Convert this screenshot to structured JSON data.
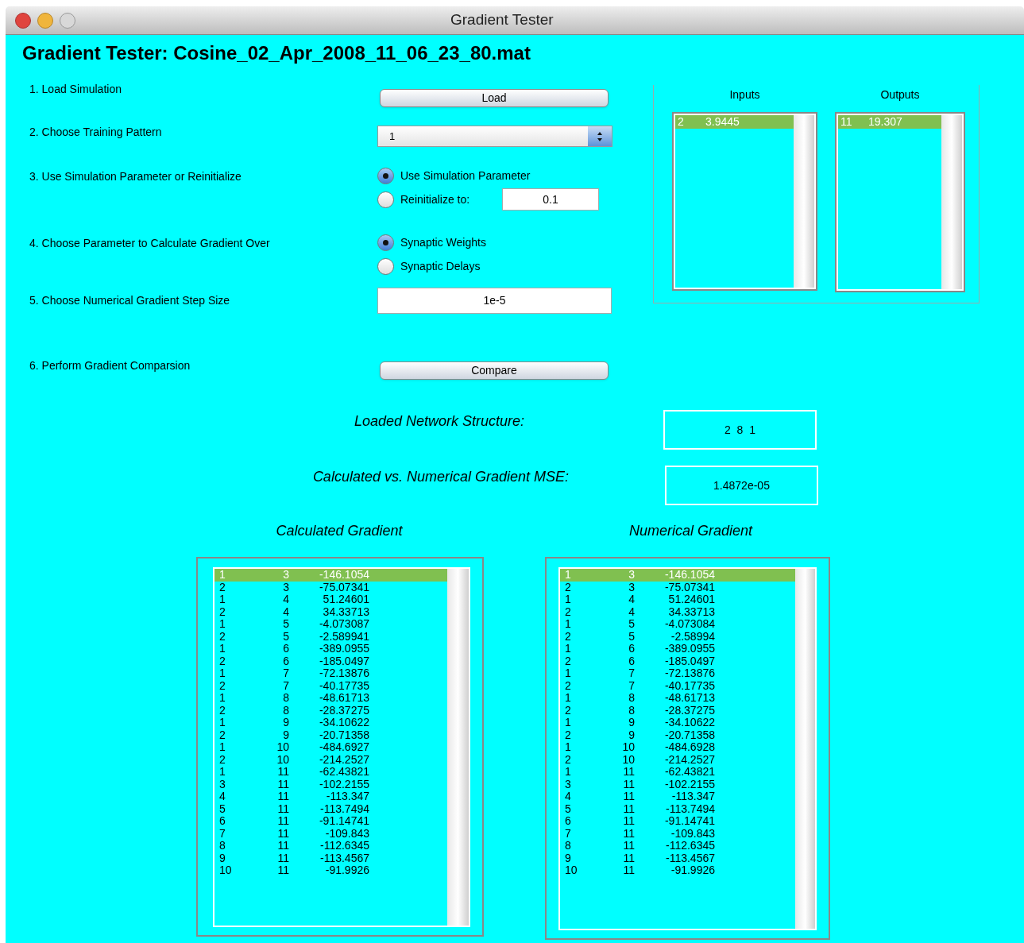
{
  "window": {
    "title": "Gradient Tester"
  },
  "heading": "Gradient Tester: Cosine_02_Apr_2008_11_06_23_80.mat",
  "steps": [
    {
      "kind": "button",
      "label": "1. Load Simulation",
      "button": "Load"
    },
    {
      "kind": "popup",
      "label": "2. Choose Training Pattern",
      "value": "1"
    },
    {
      "kind": "radios",
      "label": "3. Use Simulation Parameter or Reinitialize",
      "options": [
        {
          "label": "Use Simulation Parameter",
          "selected": true
        },
        {
          "label": "Reinitialize to:",
          "selected": false,
          "field": "0.1"
        }
      ]
    },
    {
      "kind": "radios",
      "label": "4. Choose Parameter to Calculate Gradient Over",
      "options": [
        {
          "label": "Synaptic Weights",
          "selected": true
        },
        {
          "label": "Synaptic Delays",
          "selected": false
        }
      ]
    },
    {
      "kind": "field",
      "label": "5. Choose Numerical Gradient Step Size",
      "value": "1e-5"
    },
    {
      "kind": "button",
      "label": "6. Perform Gradient Comparsion",
      "button": "Compare"
    }
  ],
  "io_panel": {
    "inputs": {
      "title": "Inputs",
      "rows": [
        {
          "cells": [
            "2",
            "3.9445"
          ],
          "selected": true
        }
      ]
    },
    "outputs": {
      "title": "Outputs",
      "rows": [
        {
          "cells": [
            "11",
            "19.307"
          ],
          "selected": true
        }
      ]
    }
  },
  "results": [
    {
      "label": "Loaded Network Structure:",
      "value": "2  8  1"
    },
    {
      "label": "Calculated vs. Numerical Gradient MSE:",
      "value": "1.4872e-05"
    }
  ],
  "gradients": [
    {
      "title": "Calculated Gradient",
      "rows": [
        {
          "cells": [
            "1",
            "3",
            "-146.1054"
          ],
          "selected": true
        },
        {
          "cells": [
            "2",
            "3",
            "-75.07341"
          ],
          "selected": false
        },
        {
          "cells": [
            "1",
            "4",
            "51.24601"
          ],
          "selected": false
        },
        {
          "cells": [
            "2",
            "4",
            "34.33713"
          ],
          "selected": false
        },
        {
          "cells": [
            "1",
            "5",
            "-4.073087"
          ],
          "selected": false
        },
        {
          "cells": [
            "2",
            "5",
            "-2.589941"
          ],
          "selected": false
        },
        {
          "cells": [
            "1",
            "6",
            "-389.0955"
          ],
          "selected": false
        },
        {
          "cells": [
            "2",
            "6",
            "-185.0497"
          ],
          "selected": false
        },
        {
          "cells": [
            "1",
            "7",
            "-72.13876"
          ],
          "selected": false
        },
        {
          "cells": [
            "2",
            "7",
            "-40.17735"
          ],
          "selected": false
        },
        {
          "cells": [
            "1",
            "8",
            "-48.61713"
          ],
          "selected": false
        },
        {
          "cells": [
            "2",
            "8",
            "-28.37275"
          ],
          "selected": false
        },
        {
          "cells": [
            "1",
            "9",
            "-34.10622"
          ],
          "selected": false
        },
        {
          "cells": [
            "2",
            "9",
            "-20.71358"
          ],
          "selected": false
        },
        {
          "cells": [
            "1",
            "10",
            "-484.6927"
          ],
          "selected": false
        },
        {
          "cells": [
            "2",
            "10",
            "-214.2527"
          ],
          "selected": false
        },
        {
          "cells": [
            "1",
            "11",
            "-62.43821"
          ],
          "selected": false
        },
        {
          "cells": [
            "3",
            "11",
            "-102.2155"
          ],
          "selected": false
        },
        {
          "cells": [
            "4",
            "11",
            "-113.347"
          ],
          "selected": false
        },
        {
          "cells": [
            "5",
            "11",
            "-113.7494"
          ],
          "selected": false
        },
        {
          "cells": [
            "6",
            "11",
            "-91.14741"
          ],
          "selected": false
        },
        {
          "cells": [
            "7",
            "11",
            "-109.843"
          ],
          "selected": false
        },
        {
          "cells": [
            "8",
            "11",
            "-112.6345"
          ],
          "selected": false
        },
        {
          "cells": [
            "9",
            "11",
            "-113.4567"
          ],
          "selected": false
        },
        {
          "cells": [
            "10",
            "11",
            "-91.9926"
          ],
          "selected": false
        }
      ]
    },
    {
      "title": "Numerical Gradient",
      "rows": [
        {
          "cells": [
            "1",
            "3",
            "-146.1054"
          ],
          "selected": true
        },
        {
          "cells": [
            "2",
            "3",
            "-75.07341"
          ],
          "selected": false
        },
        {
          "cells": [
            "1",
            "4",
            "51.24601"
          ],
          "selected": false
        },
        {
          "cells": [
            "2",
            "4",
            "34.33713"
          ],
          "selected": false
        },
        {
          "cells": [
            "1",
            "5",
            "-4.073084"
          ],
          "selected": false
        },
        {
          "cells": [
            "2",
            "5",
            "-2.58994"
          ],
          "selected": false
        },
        {
          "cells": [
            "1",
            "6",
            "-389.0955"
          ],
          "selected": false
        },
        {
          "cells": [
            "2",
            "6",
            "-185.0497"
          ],
          "selected": false
        },
        {
          "cells": [
            "1",
            "7",
            "-72.13876"
          ],
          "selected": false
        },
        {
          "cells": [
            "2",
            "7",
            "-40.17735"
          ],
          "selected": false
        },
        {
          "cells": [
            "1",
            "8",
            "-48.61713"
          ],
          "selected": false
        },
        {
          "cells": [
            "2",
            "8",
            "-28.37275"
          ],
          "selected": false
        },
        {
          "cells": [
            "1",
            "9",
            "-34.10622"
          ],
          "selected": false
        },
        {
          "cells": [
            "2",
            "9",
            "-20.71358"
          ],
          "selected": false
        },
        {
          "cells": [
            "1",
            "10",
            "-484.6928"
          ],
          "selected": false
        },
        {
          "cells": [
            "2",
            "10",
            "-214.2527"
          ],
          "selected": false
        },
        {
          "cells": [
            "1",
            "11",
            "-62.43821"
          ],
          "selected": false
        },
        {
          "cells": [
            "3",
            "11",
            "-102.2155"
          ],
          "selected": false
        },
        {
          "cells": [
            "4",
            "11",
            "-113.347"
          ],
          "selected": false
        },
        {
          "cells": [
            "5",
            "11",
            "-113.7494"
          ],
          "selected": false
        },
        {
          "cells": [
            "6",
            "11",
            "-91.14741"
          ],
          "selected": false
        },
        {
          "cells": [
            "7",
            "11",
            "-109.843"
          ],
          "selected": false
        },
        {
          "cells": [
            "8",
            "11",
            "-112.6345"
          ],
          "selected": false
        },
        {
          "cells": [
            "9",
            "11",
            "-113.4567"
          ],
          "selected": false
        },
        {
          "cells": [
            "10",
            "11",
            "-91.9926"
          ],
          "selected": false
        }
      ]
    }
  ]
}
